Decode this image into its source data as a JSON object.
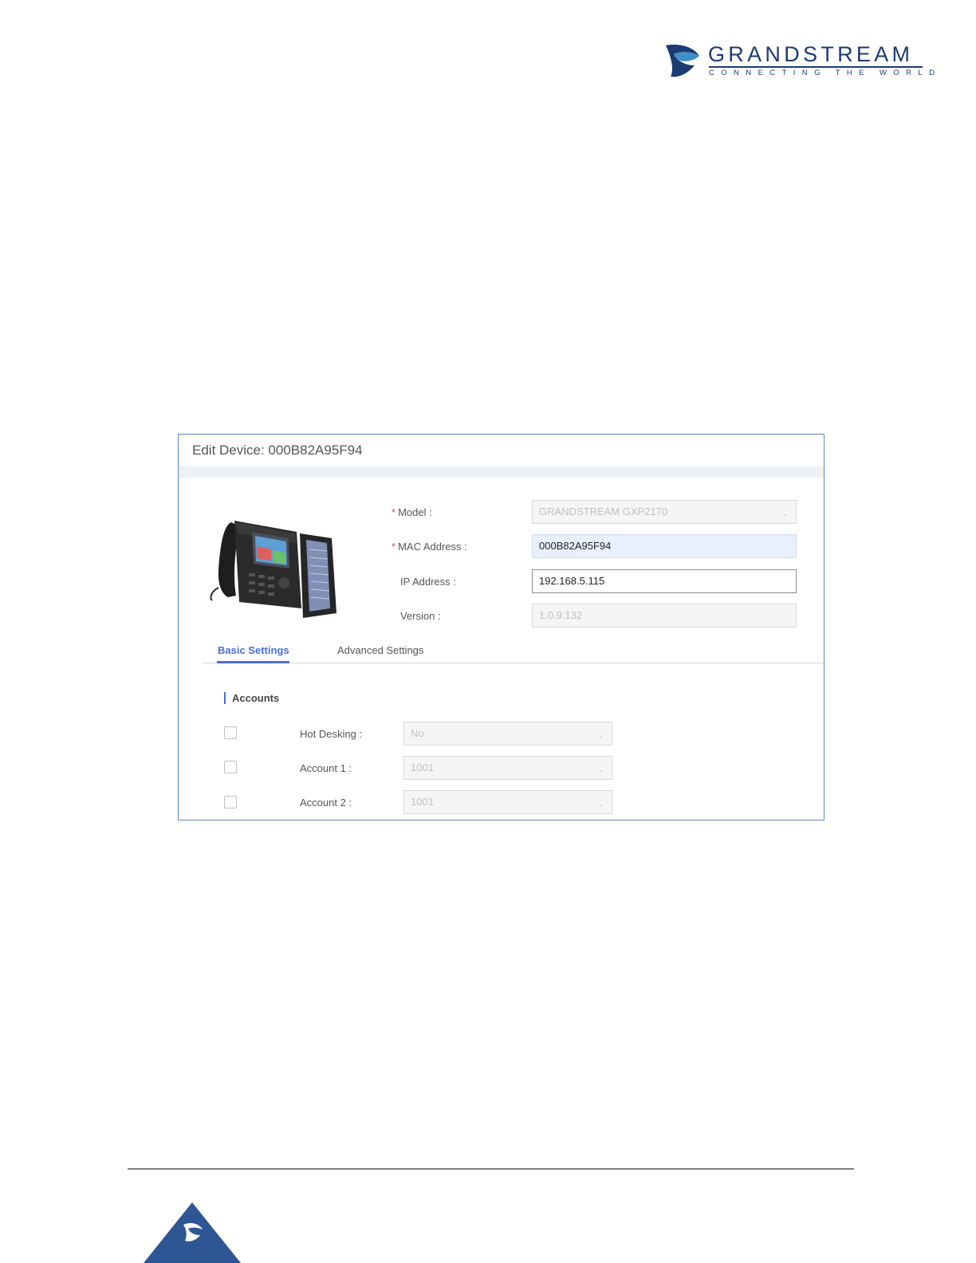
{
  "brand": {
    "name": "GRANDSTREAM",
    "tagline": "CONNECTING THE WORLD",
    "color": "#1c3a73"
  },
  "dialog": {
    "title": "Edit Device: 000B82A95F94",
    "fields": {
      "model": {
        "label": "Model :",
        "required": "*",
        "value": "GRANDSTREAM GXP2170"
      },
      "mac": {
        "label": "MAC Address :",
        "required": "*",
        "value": "000B82A95F94"
      },
      "ip": {
        "label": "IP Address :",
        "value": "192.168.5.115"
      },
      "version": {
        "label": "Version :",
        "value": "1.0.9.132"
      }
    },
    "tabs": {
      "basic": "Basic Settings",
      "advanced": "Advanced Settings"
    },
    "section": {
      "title": "Accounts"
    },
    "rows": [
      {
        "label": "Hot Desking :",
        "value": "No"
      },
      {
        "label": "Account 1 :",
        "value": "1001"
      },
      {
        "label": "Account 2 :",
        "value": "1001"
      }
    ]
  },
  "colors": {
    "accent": "#4a6ee0",
    "required": "#e24c4c",
    "dialog_border": "#5b86c4"
  }
}
